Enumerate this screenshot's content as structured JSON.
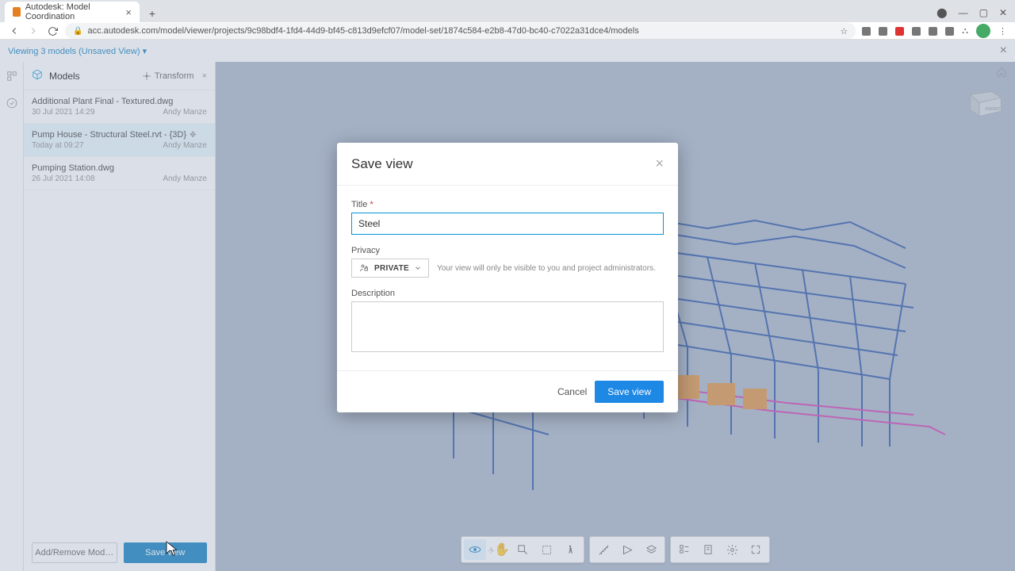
{
  "browser": {
    "tab_title": "Autodesk: Model Coordination",
    "url": "acc.autodesk.com/model/viewer/projects/9c98bdf4-1fd4-44d9-bf45-c813d9efcf07/model-set/1874c584-e2b8-47d0-bc40-c7022a31dce4/models"
  },
  "crumb": {
    "text": "Viewing 3 models (Unsaved View) ▾"
  },
  "sidebar": {
    "title": "Models",
    "transform_label": "Transform",
    "items": [
      {
        "name": "Additional Plant Final - Textured.dwg",
        "date": "30 Jul 2021 14:29",
        "user": "Andy Manze"
      },
      {
        "name": "Pump House - Structural Steel.rvt - {3D}",
        "date": "Today at 09:27",
        "user": "Andy Manze"
      },
      {
        "name": "Pumping Station.dwg",
        "date": "26 Jul 2021 14:08",
        "user": "Andy Manze"
      }
    ],
    "add_remove": "Add/Remove Mod…",
    "save_view": "Save view"
  },
  "modal": {
    "title": "Save view",
    "title_label": "Title",
    "title_value": "Steel",
    "privacy_label": "Privacy",
    "privacy_value": "PRIVATE",
    "privacy_hint": "Your view will only be visible to you and project administrators.",
    "desc_label": "Description",
    "cancel": "Cancel",
    "save": "Save view"
  },
  "viewcube": {
    "face": "FRONT"
  }
}
